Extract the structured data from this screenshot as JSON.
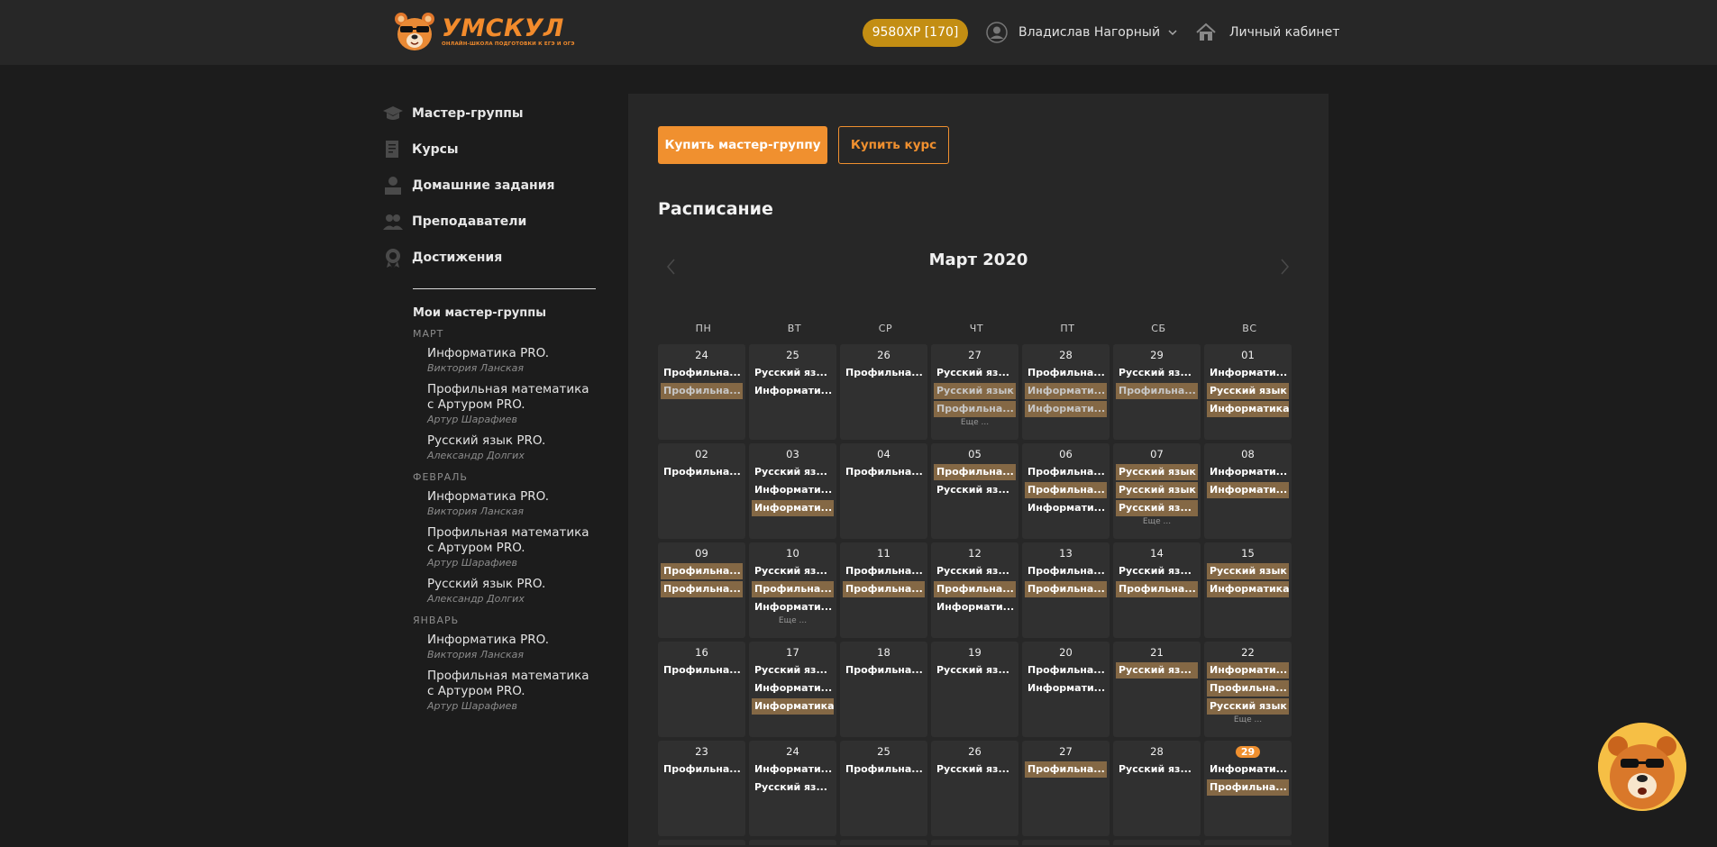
{
  "header": {
    "logo_name": "УМСКУЛ",
    "logo_tagline": "ОНЛАЙН-ШКОЛА ПОДГОТОВКИ К ЕГЭ И ОГЭ",
    "xp": "9580XP [170]",
    "user_name": "Владислав Нагорный",
    "cabinet_label": "Личный кабинет"
  },
  "sidebar": {
    "nav": [
      {
        "label": "Мастер-группы",
        "icon": "graduation-cap-icon"
      },
      {
        "label": "Курсы",
        "icon": "document-icon"
      },
      {
        "label": "Домашние задания",
        "icon": "student-desk-icon"
      },
      {
        "label": "Преподаватели",
        "icon": "teachers-icon"
      },
      {
        "label": "Достижения",
        "icon": "medal-icon"
      }
    ],
    "my_groups_title": "Мои мастер-группы",
    "months": [
      {
        "label": "МАРТ",
        "courses": [
          {
            "name": "Информатика PRO.",
            "teacher": "Виктория Ланская"
          },
          {
            "name": "Профильная математика с Артуром PRO.",
            "teacher": "Артур Шарафиев"
          },
          {
            "name": "Русский язык PRO.",
            "teacher": "Александр Долгих"
          }
        ]
      },
      {
        "label": "ФЕВРАЛЬ",
        "courses": [
          {
            "name": "Информатика PRO.",
            "teacher": "Виктория Ланская"
          },
          {
            "name": "Профильная математика с Артуром PRO.",
            "teacher": "Артур Шарафиев"
          },
          {
            "name": "Русский язык PRO.",
            "teacher": "Александр Долгих"
          }
        ]
      },
      {
        "label": "ЯНВАРЬ",
        "courses": [
          {
            "name": "Информатика PRO.",
            "teacher": "Виктория Ланская"
          },
          {
            "name": "Профильная математика с Артуром PRO.",
            "teacher": "Артур Шарафиев"
          }
        ]
      }
    ]
  },
  "main": {
    "buy_group_button": "Купить мастер-группу",
    "buy_course_button": "Купить курс",
    "schedule_title": "Расписание",
    "calendar_title": "Март 2020",
    "weekdays": [
      "ПН",
      "ВТ",
      "СР",
      "ЧТ",
      "ПТ",
      "СБ",
      "ВС"
    ],
    "weeks": [
      [
        {
          "day": "24",
          "events": [
            {
              "t": "Профильна..."
            },
            {
              "t": "Профильна...",
              "hl": true,
              "dim": true
            }
          ]
        },
        {
          "day": "25",
          "events": [
            {
              "t": "Русский яз..."
            },
            {
              "t": "Информати..."
            }
          ]
        },
        {
          "day": "26",
          "events": [
            {
              "t": "Профильна..."
            }
          ]
        },
        {
          "day": "27",
          "events": [
            {
              "t": "Русский яз..."
            },
            {
              "t": "Русский язык",
              "hl": true,
              "dim": true
            },
            {
              "t": "Профильна...",
              "hl": true,
              "dim": true
            }
          ],
          "more": "Еще ..."
        },
        {
          "day": "28",
          "events": [
            {
              "t": "Профильна..."
            },
            {
              "t": "Информати...",
              "hl": true,
              "dim": true
            },
            {
              "t": "Информати...",
              "hl": true,
              "dim": true
            }
          ]
        },
        {
          "day": "29",
          "events": [
            {
              "t": "Русский яз..."
            },
            {
              "t": "Профильна...",
              "hl": true,
              "dim": true
            }
          ]
        },
        {
          "day": "01",
          "events": [
            {
              "t": "Информати..."
            },
            {
              "t": "Русский язык",
              "hl": true
            },
            {
              "t": "Информатика",
              "hl": true
            }
          ]
        }
      ],
      [
        {
          "day": "02",
          "events": [
            {
              "t": "Профильна..."
            }
          ]
        },
        {
          "day": "03",
          "events": [
            {
              "t": "Русский яз..."
            },
            {
              "t": "Информати..."
            },
            {
              "t": "Информати...",
              "hl": true
            }
          ]
        },
        {
          "day": "04",
          "events": [
            {
              "t": "Профильна..."
            }
          ]
        },
        {
          "day": "05",
          "events": [
            {
              "t": "Профильна...",
              "hl": true
            },
            {
              "t": "Русский яз..."
            }
          ]
        },
        {
          "day": "06",
          "events": [
            {
              "t": "Профильна..."
            },
            {
              "t": "Профильна...",
              "hl": true
            },
            {
              "t": "Информати..."
            }
          ]
        },
        {
          "day": "07",
          "events": [
            {
              "t": "Русский язык",
              "hl": true
            },
            {
              "t": "Русский язык",
              "hl": true
            },
            {
              "t": "Русский яз...",
              "hl": true
            }
          ],
          "more": "Еще ..."
        },
        {
          "day": "08",
          "events": [
            {
              "t": "Информати..."
            },
            {
              "t": "Информати...",
              "hl": true
            }
          ]
        }
      ],
      [
        {
          "day": "09",
          "events": [
            {
              "t": "Профильна...",
              "hl": true
            },
            {
              "t": "Профильна...",
              "hl": true
            }
          ]
        },
        {
          "day": "10",
          "events": [
            {
              "t": "Русский яз..."
            },
            {
              "t": "Профильна...",
              "hl": true
            },
            {
              "t": "Информати..."
            }
          ],
          "more": "Еще ..."
        },
        {
          "day": "11",
          "events": [
            {
              "t": "Профильна..."
            },
            {
              "t": "Профильна...",
              "hl": true
            }
          ]
        },
        {
          "day": "12",
          "events": [
            {
              "t": "Русский яз..."
            },
            {
              "t": "Профильна...",
              "hl": true
            },
            {
              "t": "Информати..."
            }
          ]
        },
        {
          "day": "13",
          "events": [
            {
              "t": "Профильна..."
            },
            {
              "t": "Профильна...",
              "hl": true
            }
          ]
        },
        {
          "day": "14",
          "events": [
            {
              "t": "Русский яз..."
            },
            {
              "t": "Профильна...",
              "hl": true
            }
          ]
        },
        {
          "day": "15",
          "events": [
            {
              "t": "Русский язык",
              "hl": true
            },
            {
              "t": "Информатика",
              "hl": true
            }
          ]
        }
      ],
      [
        {
          "day": "16",
          "events": [
            {
              "t": "Профильна..."
            }
          ]
        },
        {
          "day": "17",
          "events": [
            {
              "t": "Русский яз..."
            },
            {
              "t": "Информати..."
            },
            {
              "t": "Информатика",
              "hl": true
            }
          ]
        },
        {
          "day": "18",
          "events": [
            {
              "t": "Профильна..."
            }
          ]
        },
        {
          "day": "19",
          "events": [
            {
              "t": "Русский яз..."
            }
          ]
        },
        {
          "day": "20",
          "events": [
            {
              "t": "Профильна..."
            },
            {
              "t": "Информати..."
            }
          ]
        },
        {
          "day": "21",
          "events": [
            {
              "t": "Русский яз...",
              "hl": true
            }
          ]
        },
        {
          "day": "22",
          "events": [
            {
              "t": "Информати...",
              "hl": true
            },
            {
              "t": "Профильна...",
              "hl": true
            },
            {
              "t": "Русский язык",
              "hl": true
            }
          ],
          "more": "Еще ..."
        }
      ],
      [
        {
          "day": "23",
          "events": [
            {
              "t": "Профильна..."
            }
          ]
        },
        {
          "day": "24",
          "events": [
            {
              "t": "Информати..."
            },
            {
              "t": "Русский яз..."
            }
          ]
        },
        {
          "day": "25",
          "events": [
            {
              "t": "Профильна..."
            }
          ]
        },
        {
          "day": "26",
          "events": [
            {
              "t": "Русский яз..."
            }
          ]
        },
        {
          "day": "27",
          "events": [
            {
              "t": "Профильна...",
              "hl": true
            }
          ]
        },
        {
          "day": "28",
          "events": [
            {
              "t": "Русский яз..."
            }
          ]
        },
        {
          "day": "29",
          "today": true,
          "events": [
            {
              "t": "Информати..."
            },
            {
              "t": "Профильна...",
              "hl": true
            }
          ]
        }
      ]
    ]
  },
  "colors": {
    "accent": "#f0902f",
    "xp_badge": "#c38e13",
    "event_highlight": "#846845",
    "page_bg": "#1c1c1c",
    "panel_bg": "#272727",
    "cell_bg": "#303030"
  }
}
